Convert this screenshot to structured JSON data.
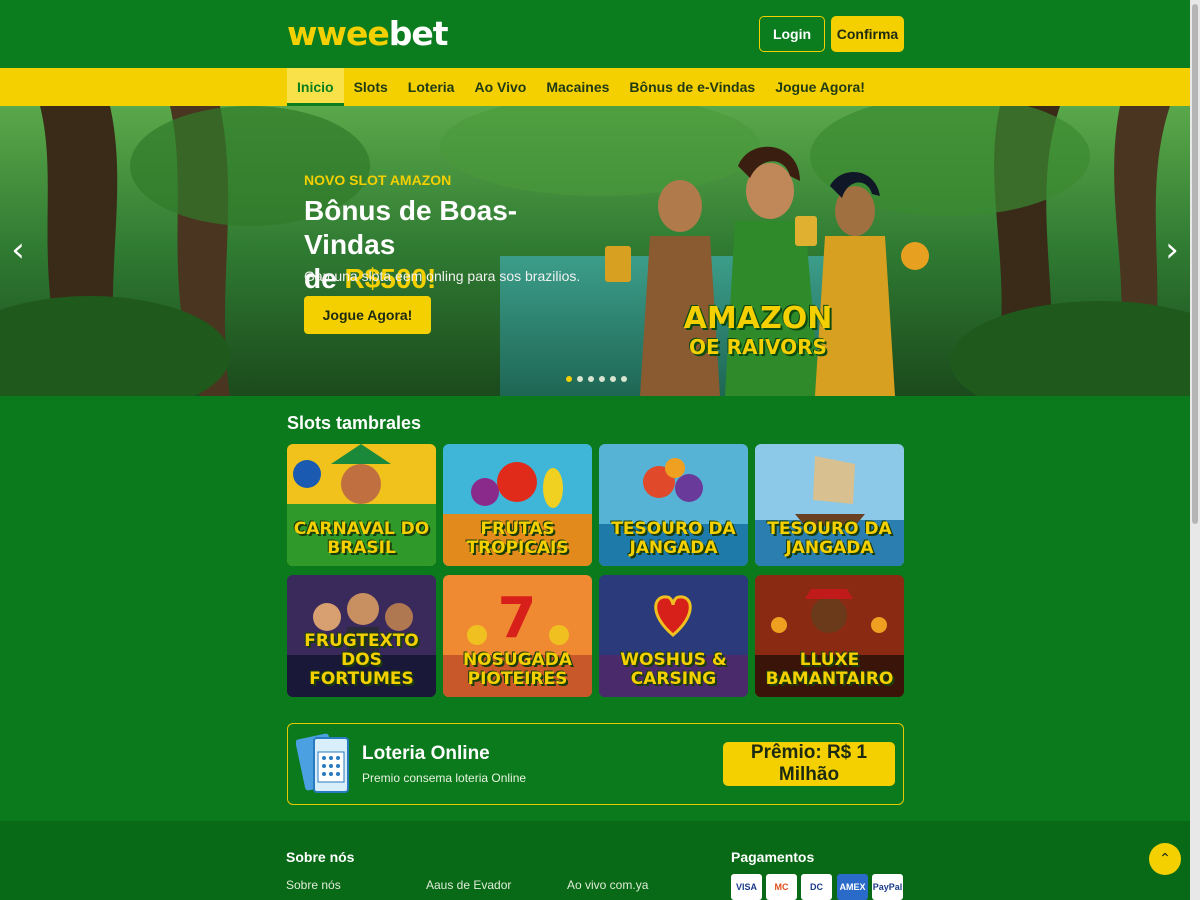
{
  "header": {
    "logo_part1": "wwee",
    "logo_part2": "bet",
    "login_label": "Login",
    "confirm_label": "Confirma"
  },
  "nav": {
    "items": [
      {
        "label": "Inicio",
        "active": true
      },
      {
        "label": "Slots"
      },
      {
        "label": "Loteria"
      },
      {
        "label": "Ao Vivo"
      },
      {
        "label": "Macaines"
      },
      {
        "label": "Bônus de e-Vindas"
      },
      {
        "label": "Jogue Agora!"
      }
    ]
  },
  "hero": {
    "kicker": "NOVO SLOT AMAZON",
    "title_line1": "Bônus de Boas-Vindas",
    "title_prefix": "de ",
    "amount": "R$500!",
    "subtitle": "Gamuna slota eem onling para sos brazilios.",
    "cta_label": "Jogue Agora!",
    "game_title_1": "AMAZON",
    "game_title_2": "OE RAIVORS",
    "slide_count": 6,
    "active_slide": 1,
    "icons": {
      "prev": "chevron-left-icon",
      "next": "chevron-right-icon"
    }
  },
  "slots": {
    "title": "Slots tambrales",
    "games": [
      {
        "name": "CARNAVAL DO BRASIL",
        "color_top": "#f2c21c",
        "color_bottom": "#2f9a2a"
      },
      {
        "name": "FRUTAS TROPICAIS",
        "color_top": "#3fb5d8",
        "color_bottom": "#e28a1c"
      },
      {
        "name": "TESOURO DA JANGADA",
        "color_top": "#56b3d6",
        "color_bottom": "#1e7aa8"
      },
      {
        "name": "TESOURO DA JANGADA",
        "color_top": "#8cc9e8",
        "color_bottom": "#2a7fb0"
      },
      {
        "name": "FRUGTEXTO DOS FORTUMES",
        "color_top": "#3a2a5c",
        "color_bottom": "#1a1838"
      },
      {
        "name": "NOSUGADA PIOTEIRES",
        "color_top": "#f08a32",
        "color_bottom": "#c8582a"
      },
      {
        "name": "WOSHUS & CARSING",
        "color_top": "#2a3a7a",
        "color_bottom": "#4a2a6a"
      },
      {
        "name": "LLUXE BAMANTAIRO",
        "color_top": "#8a2a12",
        "color_bottom": "#3a1408"
      }
    ]
  },
  "lottery": {
    "title": "Loteria Online",
    "subtitle": "Premio consema loteria Online",
    "prize_label": "Prêmio: R$ 1 Milhão",
    "icon": "lottery-ticket-icon"
  },
  "footer": {
    "about_heading": "Sobre nós",
    "links": [
      "Sobre nós",
      "Aaus de Evador",
      "Ao vivo com.ya"
    ],
    "payments_heading": "Pagamentos",
    "payments": [
      "VISA",
      "MC",
      "DC",
      "AMEX",
      "PayPal"
    ]
  },
  "colors": {
    "brand_green": "#0b7d1e",
    "brand_yellow": "#f5d000"
  }
}
